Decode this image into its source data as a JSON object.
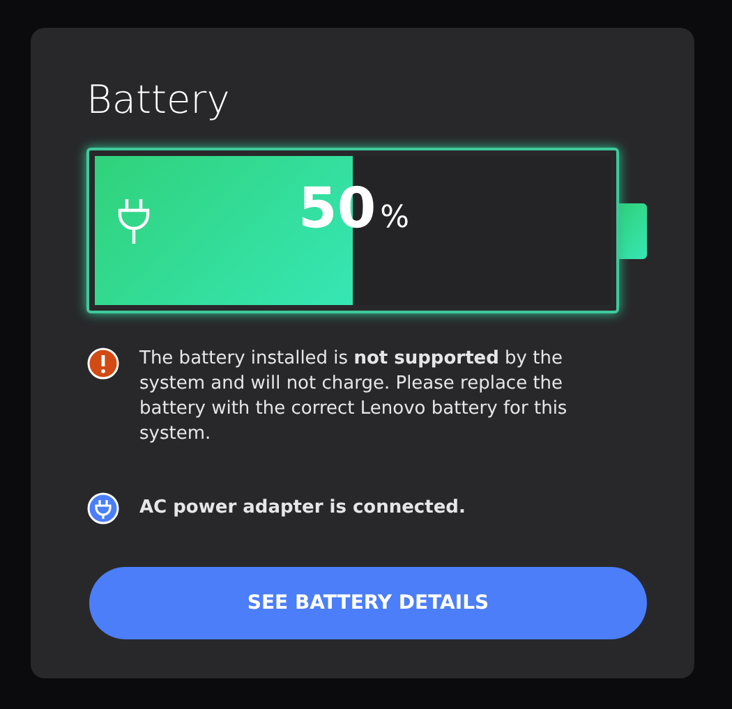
{
  "title": "Battery",
  "battery": {
    "level": 0.5,
    "percent": "50",
    "unit": "%",
    "plugged_in": true
  },
  "messages": [
    {
      "kind": "warning",
      "text": "The battery installed is **not supported** by the system and will not charge. Please replace the battery with the correct Lenovo battery for this system."
    },
    {
      "kind": "ac",
      "text": "AC power adapter is connected."
    }
  ],
  "button": "SEE BATTERY DETAILS"
}
